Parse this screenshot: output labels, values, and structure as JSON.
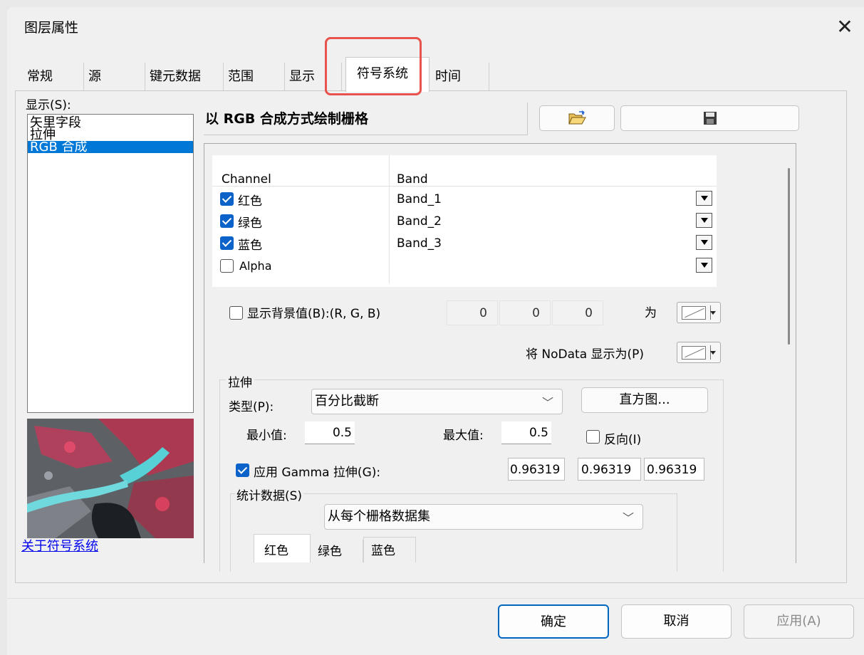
{
  "window": {
    "title": "图层属性",
    "close_glyph": "✕"
  },
  "tabs": [
    {
      "label": "常规"
    },
    {
      "label": "源"
    },
    {
      "label": "键元数据"
    },
    {
      "label": "范围"
    },
    {
      "label": "显示"
    },
    {
      "label": "符号系统",
      "active": true
    },
    {
      "label": "时间"
    }
  ],
  "left": {
    "show_label": "显示(S):",
    "items": [
      "矢里字段",
      "拉伸",
      "RGB 合成"
    ],
    "selected_index": 2,
    "about_link": "关于符号系统"
  },
  "renderer": {
    "title": "以 RGB 合成方式绘制栅格",
    "open_icon": "folder-open-icon",
    "save_icon": "floppy-save-icon"
  },
  "channels": {
    "header_channel": "Channel",
    "header_band": "Band",
    "rows": [
      {
        "channel": "红色",
        "band": "Band_1",
        "checked": true
      },
      {
        "channel": "绿色",
        "band": "Band_2",
        "checked": true
      },
      {
        "channel": "蓝色",
        "band": "Band_3",
        "checked": true
      },
      {
        "channel": "Alpha",
        "band": "",
        "checked": false
      }
    ]
  },
  "background": {
    "label": "显示背景值(B):(R, G, B)",
    "checked": false,
    "r": "0",
    "g": "0",
    "b": "0",
    "as_label": "为",
    "nodata_label": "将 NoData 显示为(P)"
  },
  "stretch": {
    "group_label": "拉伸",
    "type_label": "类型(P):",
    "type_value": "百分比截断",
    "histogram_button": "直方图...",
    "min_label": "最小值:",
    "min_value": "0.5",
    "max_label": "最大值:",
    "max_value": "0.5",
    "invert_label": "反向(I)",
    "invert_checked": false,
    "gamma_label": "应用 Gamma 拉伸(G):",
    "gamma_checked": true,
    "gamma_values": [
      "0.96319",
      "0.96319",
      "0.96319"
    ],
    "stats_label": "统计数据(S)",
    "stats_source": "从每个栅格数据集",
    "stats_tabs": [
      "红色",
      "绿色",
      "蓝色"
    ]
  },
  "footer": {
    "ok": "确定",
    "cancel": "取消",
    "apply": "应用(A)"
  },
  "colors": {
    "accent": "#0078d7",
    "highlight_box": "#e8534d",
    "checkbox": "#0b62c9"
  }
}
